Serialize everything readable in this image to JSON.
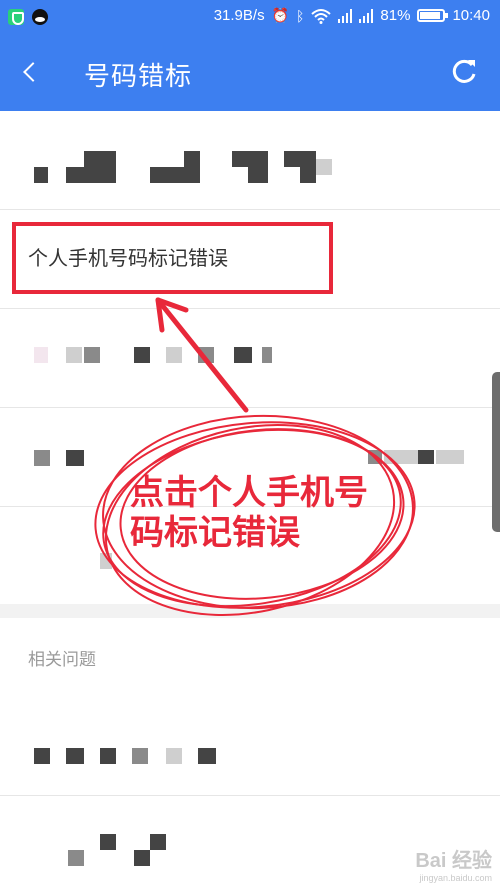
{
  "status_bar": {
    "network_speed": "31.9B/s",
    "battery_percent": "81%",
    "battery_level": 0.81,
    "time": "10:40",
    "icons": [
      "shield-icon",
      "qq-icon",
      "alarm-icon",
      "bluetooth-icon",
      "wifi-icon",
      "signal-icon",
      "signal-icon",
      "battery-icon"
    ]
  },
  "header": {
    "title": "号码错标",
    "back_icon": "chevron-left-icon",
    "refresh_icon": "refresh-icon"
  },
  "list": {
    "highlighted_item": "个人手机号码标记错误"
  },
  "related": {
    "header": "相关问题"
  },
  "annotation": {
    "text": "点击个人手机号码标记错误",
    "color": "#e8283a"
  },
  "watermark": {
    "main": "Bai 经验",
    "sub": "jingyan.baidu.com"
  },
  "colors": {
    "header_bg": "#3d7ff0",
    "annotation_red": "#e8283a"
  }
}
